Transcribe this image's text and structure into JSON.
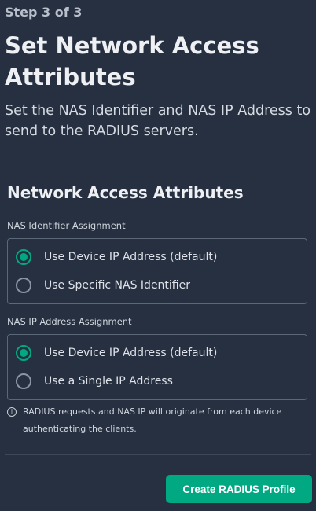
{
  "step": "Step 3 of 3",
  "title": "Set Network Access Attributes",
  "subtitle": "Set the NAS Identifier and NAS IP Address to send to the RADIUS servers.",
  "section_title": "Network Access Attributes",
  "nas_identifier": {
    "label": "NAS Identifier Assignment",
    "options": [
      {
        "label": "Use Device IP Address (default)",
        "selected": true
      },
      {
        "label": "Use Specific NAS Identifier",
        "selected": false
      }
    ]
  },
  "nas_ip": {
    "label": "NAS IP Address Assignment",
    "options": [
      {
        "label": "Use Device IP Address (default)",
        "selected": true
      },
      {
        "label": "Use a Single IP Address",
        "selected": false
      }
    ]
  },
  "info": {
    "icon": "info-icon",
    "text": "RADIUS requests and NAS IP will originate from each device authenticating the clients."
  },
  "footer": {
    "create_label": "Create RADIUS Profile"
  },
  "colors": {
    "background": "#263040",
    "accent": "#01a982"
  }
}
